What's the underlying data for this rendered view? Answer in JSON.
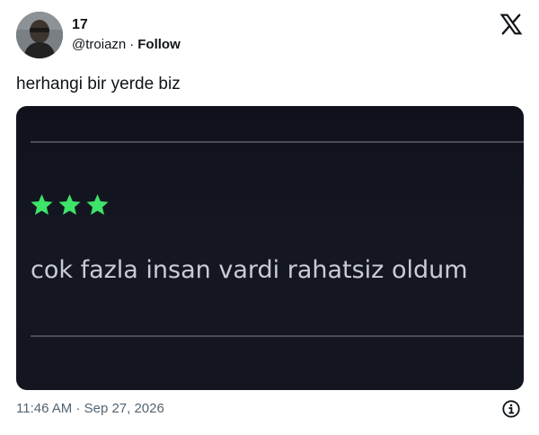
{
  "author": {
    "name": "17",
    "handle": "@troiazn",
    "separator": "·",
    "follow_label": "Follow"
  },
  "tweet": {
    "text": "herhangi bir yerde biz",
    "timestamp": "11:46 AM · Sep 27, 2026"
  },
  "media": {
    "rating": 3,
    "star_color": "#3ee36a",
    "review_text": "cok fazla insan vardi rahatsiz oldum"
  },
  "icons": {
    "logo": "x-logo-icon",
    "info": "info-icon"
  }
}
